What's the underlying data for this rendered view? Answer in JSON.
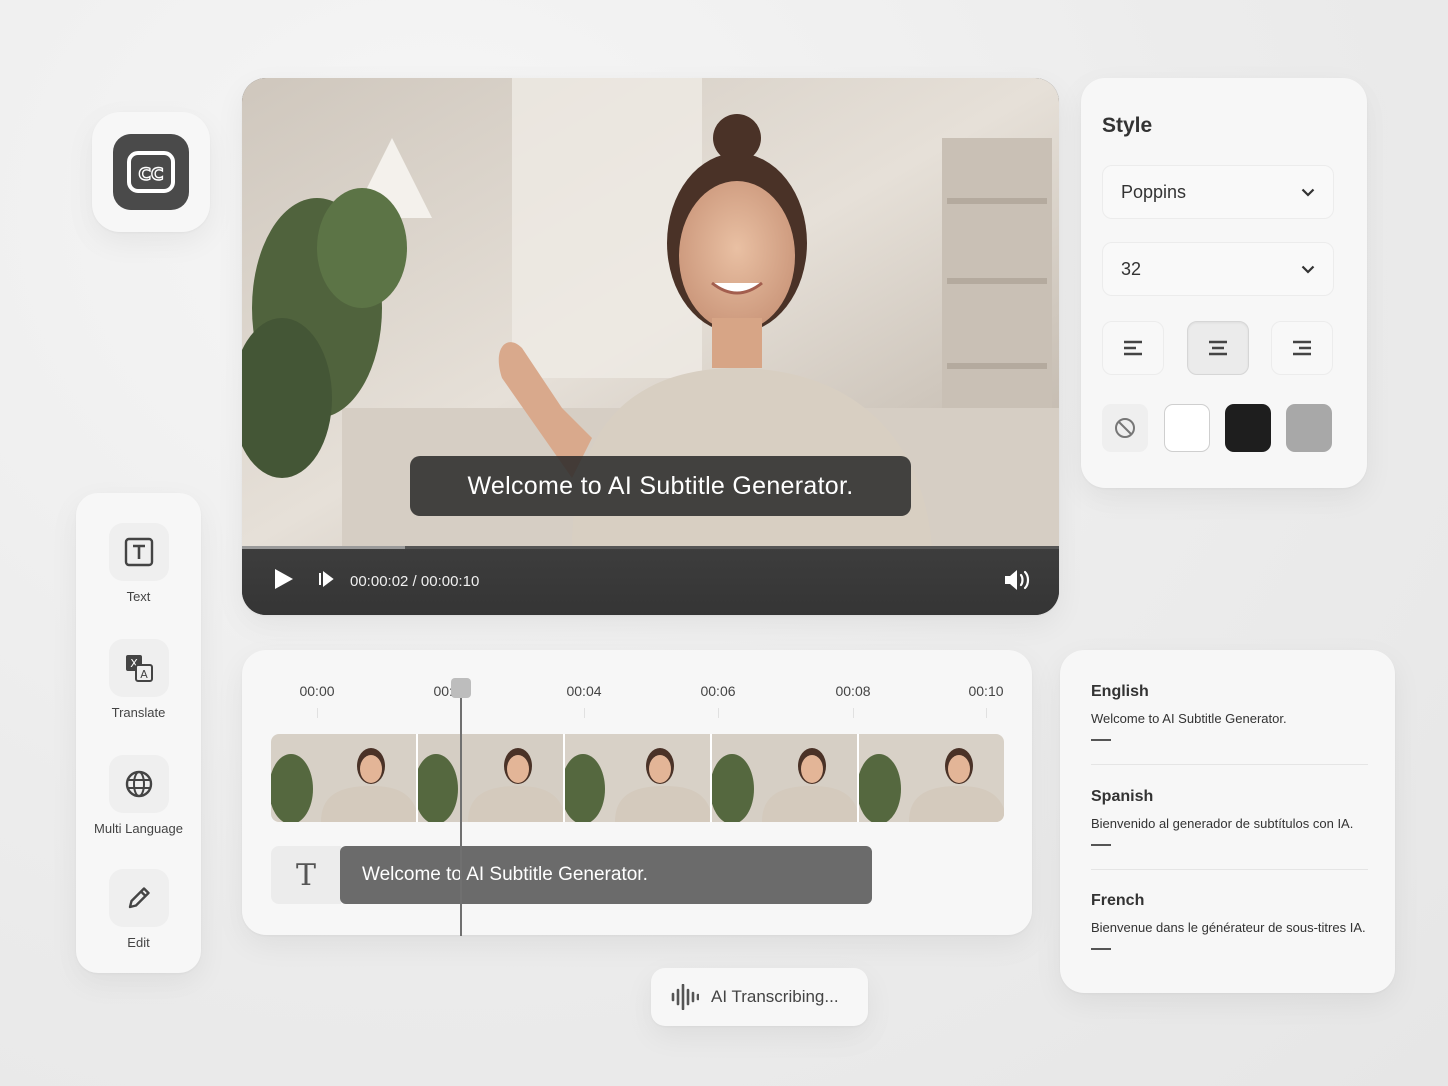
{
  "tools": {
    "items": [
      {
        "label": "Text",
        "icon": "text-icon"
      },
      {
        "label": "Translate",
        "icon": "translate-icon"
      },
      {
        "label": "Multi Language",
        "icon": "globe-icon"
      },
      {
        "label": "Edit",
        "icon": "pencil-icon"
      }
    ]
  },
  "player": {
    "subtitle": "Welcome to AI Subtitle Generator.",
    "time": "00:00:02 / 00:00:10",
    "progress": 0.2
  },
  "style": {
    "title": "Style",
    "font_value": "Poppins",
    "size_value": "32",
    "alignment_options": [
      "left",
      "center",
      "right"
    ],
    "alignment_selected": "center",
    "colors": [
      "none",
      "#ffffff",
      "#1e1e1e",
      "#a8a8a8"
    ]
  },
  "timeline": {
    "ticks": [
      "00:00",
      "00:02",
      "00:04",
      "00:06",
      "00:08",
      "00:10"
    ],
    "clip_text": "Welcome to AI Subtitle Generator.",
    "playhead": "00:02"
  },
  "languages": [
    {
      "name": "English",
      "text": "Welcome to AI Subtitle Generator."
    },
    {
      "name": "Spanish",
      "text": "Bienvenido al generador de subtítulos con IA."
    },
    {
      "name": "French",
      "text": "Bienvenue dans le générateur de sous-titres IA."
    }
  ],
  "status": {
    "label": "AI Transcribing..."
  }
}
